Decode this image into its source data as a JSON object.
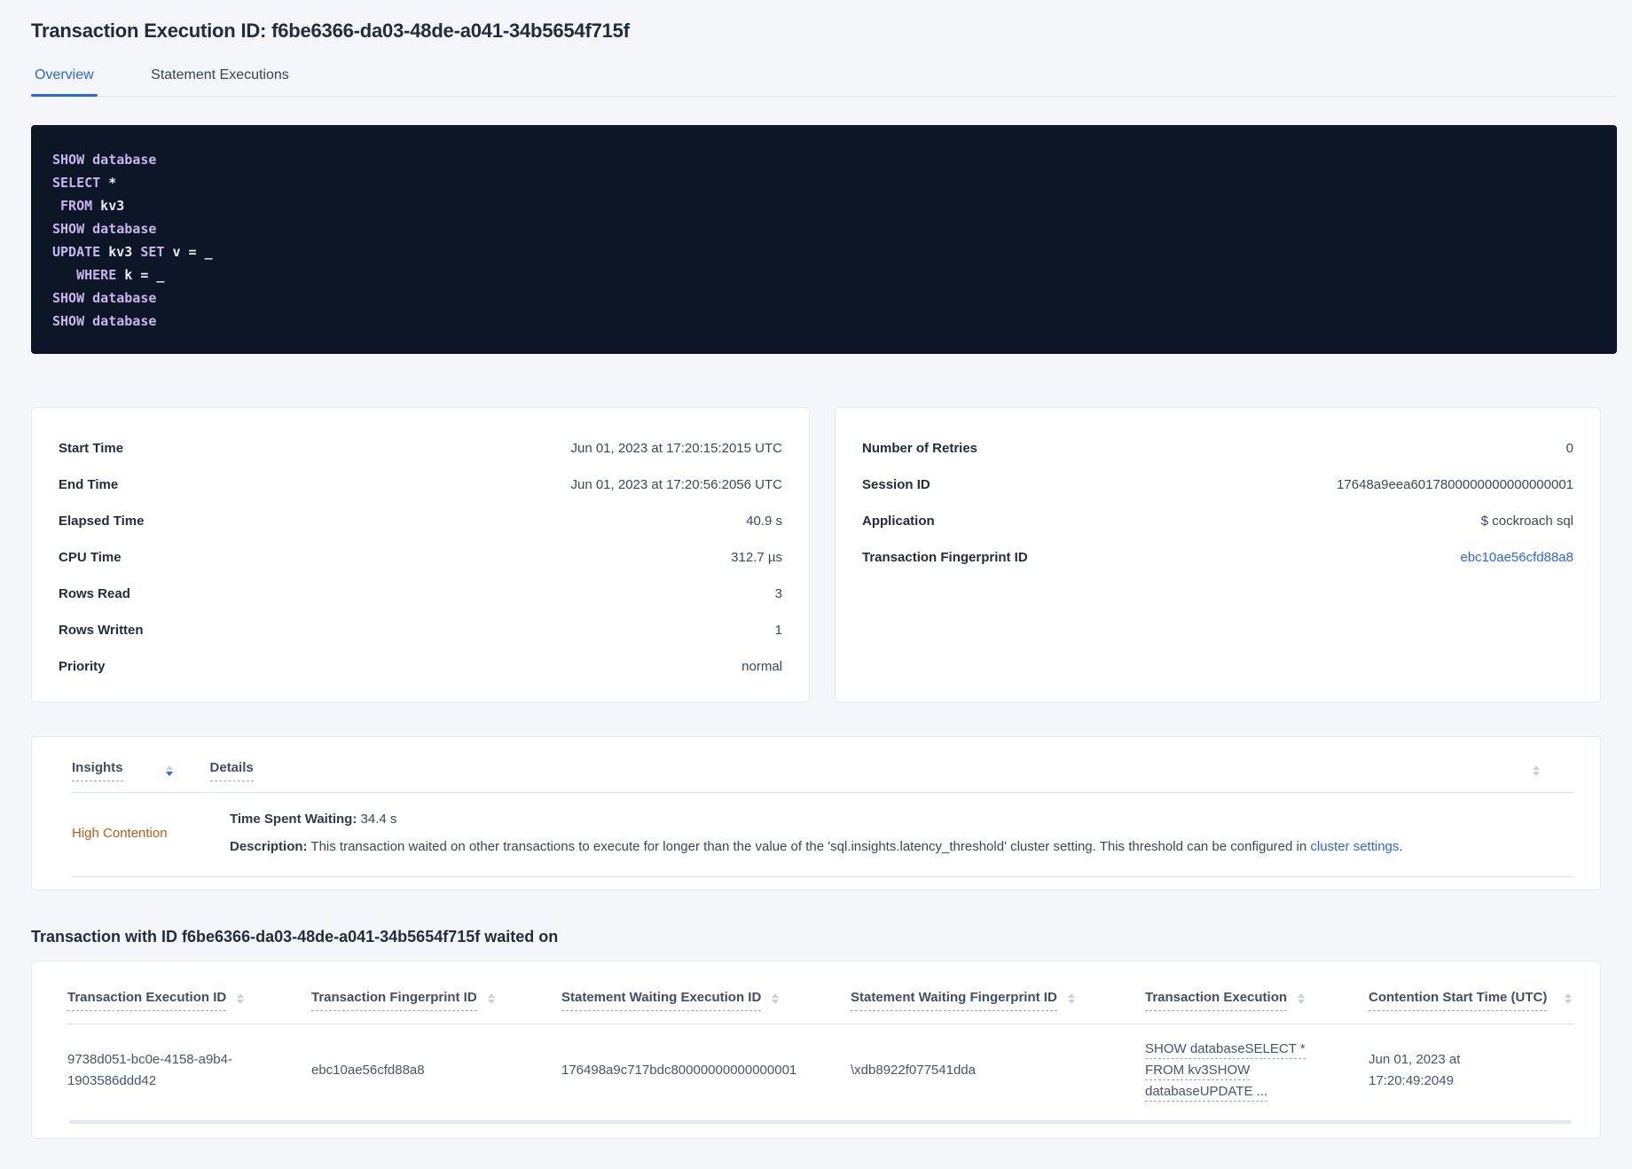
{
  "colors": {
    "accent_blue": "#2866f2",
    "insight_orange": "#bd5a10",
    "code_background": "#0d1626",
    "code_keyword": "#c7b5ec",
    "code_text": "#e9edf4",
    "page_background": "#f4f6fa"
  },
  "header": {
    "title": "Transaction Execution ID: f6be6366-da03-48de-a041-34b5654f715f",
    "tabs": [
      {
        "label": "Overview",
        "active": true
      },
      {
        "label": "Statement Executions",
        "active": false
      }
    ]
  },
  "sql": {
    "lines": [
      [
        {
          "t": "SHOW database"
        }
      ],
      [
        {
          "t": "SELECT"
        },
        {
          "t": " *"
        }
      ],
      [
        {
          "t": " FROM"
        },
        {
          "t": " kv3"
        }
      ],
      [
        {
          "t": "SHOW database"
        }
      ],
      [
        {
          "t": "UPDATE"
        },
        {
          "t": " kv3 "
        },
        {
          "t": "SET"
        },
        {
          "t": " v = _"
        }
      ],
      [
        {
          "t": "   WHERE"
        },
        {
          "t": " k = _"
        }
      ],
      [
        {
          "t": "SHOW database"
        }
      ],
      [
        {
          "t": "SHOW database"
        }
      ]
    ]
  },
  "summary": {
    "left": {
      "rows": [
        {
          "label": "Start Time",
          "value": "Jun 01, 2023 at 17:20:15:2015 UTC"
        },
        {
          "label": "End Time",
          "value": "Jun 01, 2023 at 17:20:56:2056 UTC"
        },
        {
          "label": "Elapsed Time",
          "value": "40.9 s"
        },
        {
          "label": "CPU Time",
          "value": "312.7 µs"
        },
        {
          "label": "Rows Read",
          "value": "3"
        },
        {
          "label": "Rows Written",
          "value": "1"
        },
        {
          "label": "Priority",
          "value": "normal"
        }
      ]
    },
    "right": {
      "rows": [
        {
          "label": "Number of Retries",
          "value": "0"
        },
        {
          "label": "Session ID",
          "value": "17648a9eea6017800000000000000001"
        },
        {
          "label": "Application",
          "value": "$ cockroach sql"
        },
        {
          "label": "Transaction Fingerprint ID",
          "value": "ebc10ae56cfd88a8"
        }
      ]
    }
  },
  "insights": {
    "columns": {
      "insights": "Insights",
      "details": "Details"
    },
    "row": {
      "insight": "High Contention",
      "waiting_label": "Time Spent Waiting:",
      "waiting_value": " 34.4 s",
      "description_label": "Description:",
      "description_text": " This transaction waited on other transactions to execute for longer than the value of the 'sql.insights.latency_threshold' cluster setting. This threshold can be configured in ",
      "description_link": "cluster settings",
      "description_suffix": "."
    }
  },
  "waited_on": {
    "heading": "Transaction with ID f6be6366-da03-48de-a041-34b5654f715f waited on",
    "columns": [
      "Transaction Execution ID",
      "Transaction Fingerprint ID",
      "Statement Waiting Execution ID",
      "Statement Waiting Fingerprint ID",
      "Transaction Execution",
      "Contention Start Time (UTC)"
    ],
    "row": {
      "transaction_execution_id": "9738d051-bc0e-4158-a9b4-1903586ddd42",
      "transaction_fingerprint_id": "ebc10ae56cfd88a8",
      "statement_waiting_execution_id": "176498a9c717bdc80000000000000001",
      "statement_waiting_fingerprint_id": "\\xdb8922f077541dda",
      "transaction_execution": [
        "SHOW databaseSELECT *",
        "FROM kv3SHOW",
        "databaseUPDATE ..."
      ],
      "contention_start_time": "Jun 01, 2023 at 17:20:49:2049"
    }
  }
}
